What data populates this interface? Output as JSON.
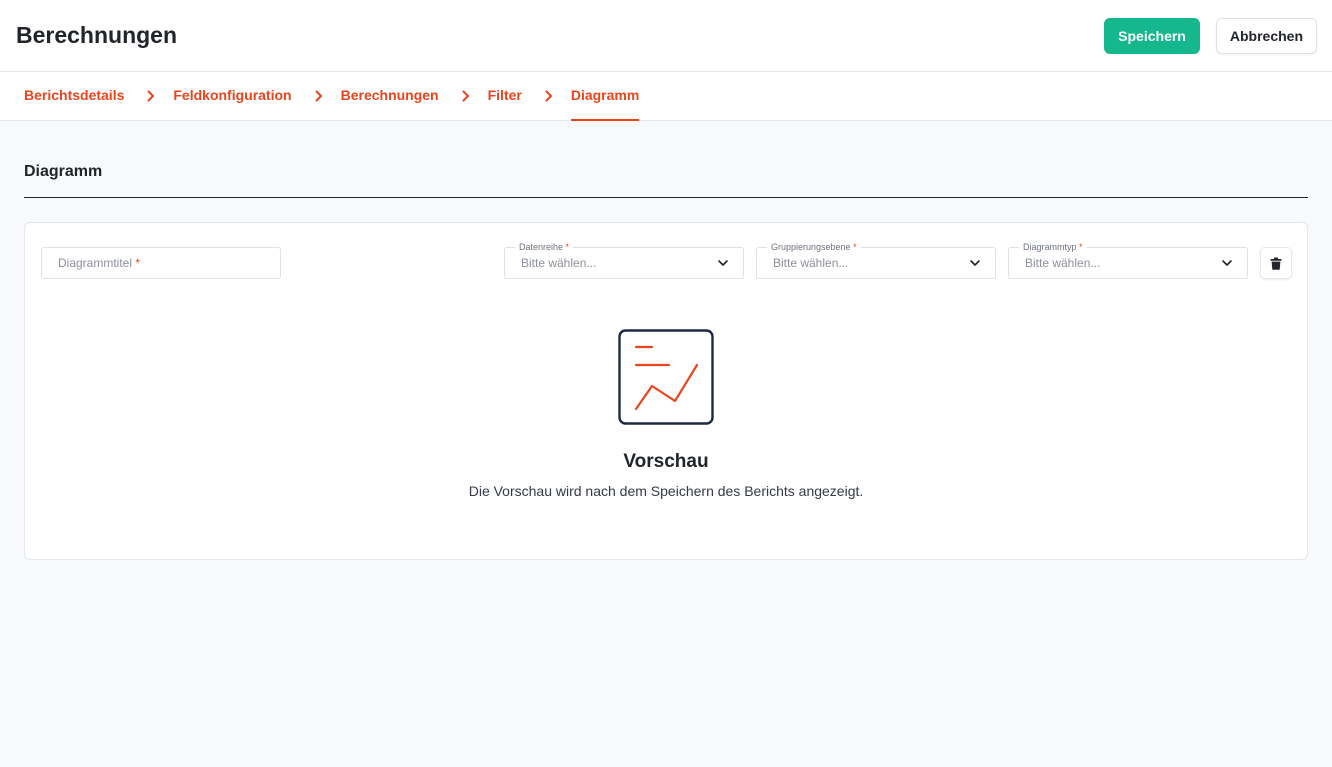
{
  "header": {
    "title": "Berechnungen",
    "save_label": "Speichern",
    "cancel_label": "Abbrechen"
  },
  "steps": [
    {
      "label": "Berichtsdetails",
      "active": false
    },
    {
      "label": "Feldkonfiguration",
      "active": false
    },
    {
      "label": "Berechnungen",
      "active": false
    },
    {
      "label": "Filter",
      "active": false
    },
    {
      "label": "Diagramm",
      "active": true
    }
  ],
  "section": {
    "title": "Diagramm"
  },
  "form": {
    "chart_title": {
      "placeholder": "Diagrammtitel",
      "required_mark": "*"
    },
    "data_series": {
      "label": "Datenreihe",
      "required_mark": "*",
      "value": "Bitte wählen..."
    },
    "grouping_level": {
      "label": "Gruppierungsebene",
      "required_mark": "*",
      "value": "Bitte wählen..."
    },
    "chart_type": {
      "label": "Diagrammtyp",
      "required_mark": "*",
      "value": "Bitte wählen..."
    }
  },
  "preview": {
    "title": "Vorschau",
    "text": "Die Vorschau wird nach dem Speichern des Berichts angezeigt."
  },
  "colors": {
    "accent": "#e8451c",
    "primary_button": "#14b88c",
    "icon_frame": "#1e2a44"
  }
}
